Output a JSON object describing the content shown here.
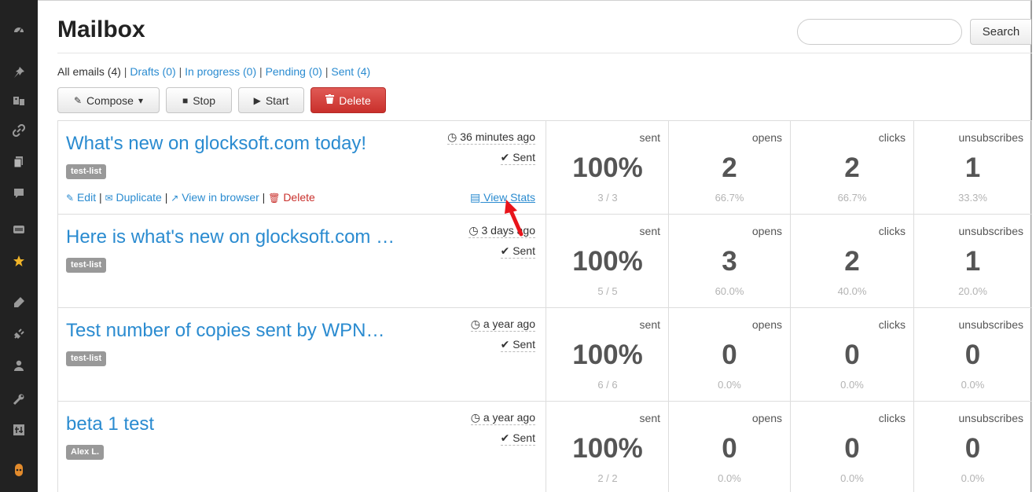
{
  "sidebar": {
    "icons": [
      "dashboard-icon",
      "pin-icon",
      "media-icon",
      "link-icon",
      "pages-icon",
      "comments-icon",
      "newsletter-icon",
      "star-icon",
      "appearance-icon",
      "plugins-icon",
      "users-icon",
      "tools-icon",
      "settings-icon",
      "collapse-icon"
    ]
  },
  "header": {
    "title": "Mailbox",
    "search_placeholder": "",
    "search_button": "Search"
  },
  "filters": {
    "all": "All emails (4)",
    "drafts": "Drafts (0)",
    "in_progress": "In progress (0)",
    "pending": "Pending (0)",
    "sent": "Sent (4)",
    "separator": "|"
  },
  "toolbar": {
    "compose": "Compose",
    "stop": "Stop",
    "start": "Start",
    "delete": "Delete"
  },
  "row_actions": {
    "edit": "Edit",
    "duplicate": "Duplicate",
    "view_in_browser": "View in browser",
    "delete": "Delete",
    "view_stats": "View Stats",
    "separator": "|"
  },
  "stat_labels": {
    "sent": "sent",
    "opens": "opens",
    "clicks": "clicks",
    "unsubscribes": "unsubscribes"
  },
  "emails": [
    {
      "title": "What's new on glocksoft.com today!",
      "list": "test-list",
      "time": "36 minutes ago",
      "status": "Sent",
      "sent_pct": "100%",
      "sent_count": "3 / 3",
      "opens": "2",
      "opens_pct": "66.7%",
      "clicks": "2",
      "clicks_pct": "66.7%",
      "unsubs": "1",
      "unsubs_pct": "33.3%"
    },
    {
      "title": "Here is what's new on glocksoft.com …",
      "list": "test-list",
      "time": "3 days ago",
      "status": "Sent",
      "sent_pct": "100%",
      "sent_count": "5 / 5",
      "opens": "3",
      "opens_pct": "60.0%",
      "clicks": "2",
      "clicks_pct": "40.0%",
      "unsubs": "1",
      "unsubs_pct": "20.0%"
    },
    {
      "title": "Test number of copies sent by WPN…",
      "list": "test-list",
      "time": "a year ago",
      "status": "Sent",
      "sent_pct": "100%",
      "sent_count": "6 / 6",
      "opens": "0",
      "opens_pct": "0.0%",
      "clicks": "0",
      "clicks_pct": "0.0%",
      "unsubs": "0",
      "unsubs_pct": "0.0%"
    },
    {
      "title": "beta 1 test",
      "list": "Alex L.",
      "time": "a year ago",
      "status": "Sent",
      "sent_pct": "100%",
      "sent_count": "2 / 2",
      "opens": "0",
      "opens_pct": "0.0%",
      "clicks": "0",
      "clicks_pct": "0.0%",
      "unsubs": "0",
      "unsubs_pct": "0.0%"
    }
  ],
  "annotation": {
    "arrow_color": "#e8141b"
  }
}
